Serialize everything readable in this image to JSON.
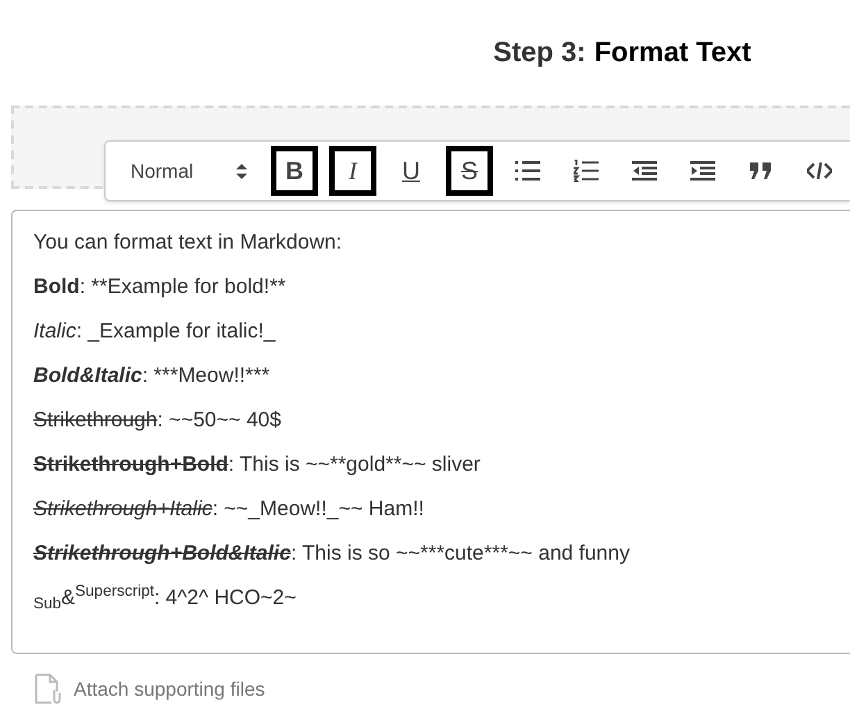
{
  "heading": {
    "step": "Step 3:",
    "title": "Format Text"
  },
  "toolbar": {
    "format_select": "Normal",
    "buttons": [
      {
        "kind": "bold",
        "glyph": "B",
        "selected": true
      },
      {
        "kind": "italic",
        "glyph": "I",
        "selected": true
      },
      {
        "kind": "underline",
        "glyph": "U",
        "selected": false
      },
      {
        "kind": "strike",
        "glyph": "S",
        "selected": true
      },
      {
        "kind": "bullet-list",
        "selected": false
      },
      {
        "kind": "ordered-list",
        "selected": false
      },
      {
        "kind": "outdent",
        "selected": false
      },
      {
        "kind": "indent",
        "selected": false
      },
      {
        "kind": "quote",
        "selected": false
      },
      {
        "kind": "code",
        "selected": false
      }
    ]
  },
  "editor": {
    "lines": [
      {
        "text": "You can format text in Markdown:"
      },
      {
        "label": "Bold",
        "bold": true,
        "italic": false,
        "strike": false,
        "text": ": **Example for bold!**"
      },
      {
        "label": "Italic",
        "bold": false,
        "italic": true,
        "strike": false,
        "text": ": _Example for italic!_"
      },
      {
        "label": "Bold&Italic",
        "bold": true,
        "italic": true,
        "strike": false,
        "text": ": ***Meow!!***"
      },
      {
        "label": "Strikethrough",
        "bold": false,
        "italic": false,
        "strike": true,
        "text": ": ~~50~~ 40$"
      },
      {
        "label": "Strikethrough+Bold",
        "bold": true,
        "italic": false,
        "strike": true,
        "text": ": This is ~~**gold**~~ sliver"
      },
      {
        "label": "Strikethrough+Italic",
        "bold": false,
        "italic": true,
        "strike": true,
        "text": ": ~~_Meow!!_~~ Ham!!"
      },
      {
        "label": "Strikethrough+Bold&Italic",
        "bold": true,
        "italic": true,
        "strike": true,
        "text": ": This is so ~~***cute***~~ and funny"
      },
      {
        "label": "$_{Sub}$&$^{Superscript}$",
        "bold": false,
        "italic": false,
        "strike": false,
        "text": ": 4^2^ HCO~2~"
      }
    ]
  },
  "attach": "Attach supporting files"
}
